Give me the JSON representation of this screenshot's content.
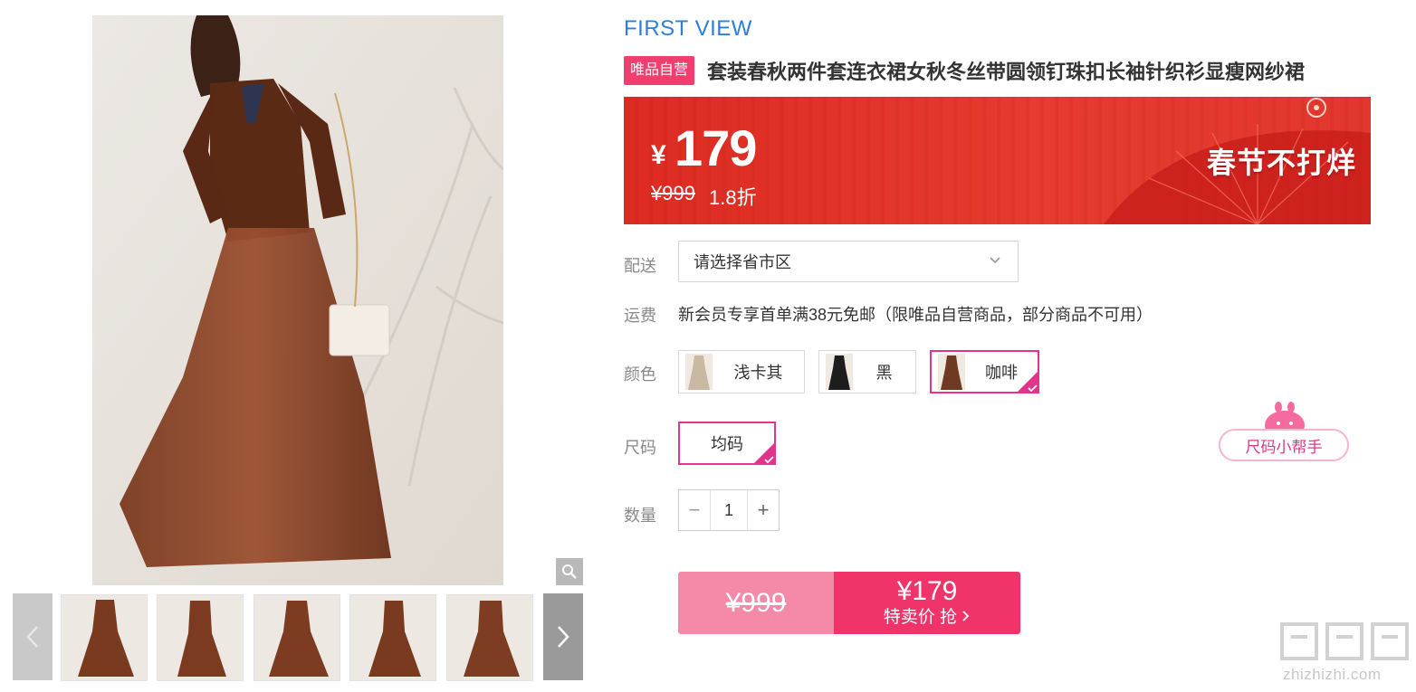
{
  "brand": "FIRST VIEW",
  "badge": "唯品自营",
  "title": "套装春秋两件套连衣裙女秋冬丝带圆领钉珠扣长袖针织衫显瘦网纱裙",
  "price": {
    "currency": "¥",
    "value": "179",
    "original": "¥999",
    "discount": "1.8折",
    "promo": "春节不打烊"
  },
  "delivery": {
    "label": "配送",
    "placeholder": "请选择省市区"
  },
  "shipping": {
    "label": "运费",
    "text": "新会员专享首单满38元免邮（限唯品自营商品，部分商品不可用）"
  },
  "color": {
    "label": "颜色",
    "options": [
      {
        "name": "浅卡其",
        "swatch": "#c9b8a2",
        "selected": false
      },
      {
        "name": "黑",
        "swatch": "#1d1d1d",
        "selected": false
      },
      {
        "name": "咖啡",
        "swatch": "#6e3a22",
        "selected": true
      }
    ]
  },
  "size": {
    "label": "尺码",
    "options": [
      {
        "name": "均码",
        "selected": true
      }
    ],
    "helper": "尺码小帮手"
  },
  "quantity": {
    "label": "数量",
    "value": "1",
    "minus": "−",
    "plus": "+"
  },
  "buy": {
    "original": "¥999",
    "price": "¥179",
    "action": "特卖价 抢"
  },
  "watermark": {
    "url": "zhizhizhi.com"
  },
  "colors": {
    "accent": "#f0346a",
    "select_border": "#e0358b",
    "brand_blue": "#2b7fd9",
    "banner_red": "#e2372e"
  }
}
